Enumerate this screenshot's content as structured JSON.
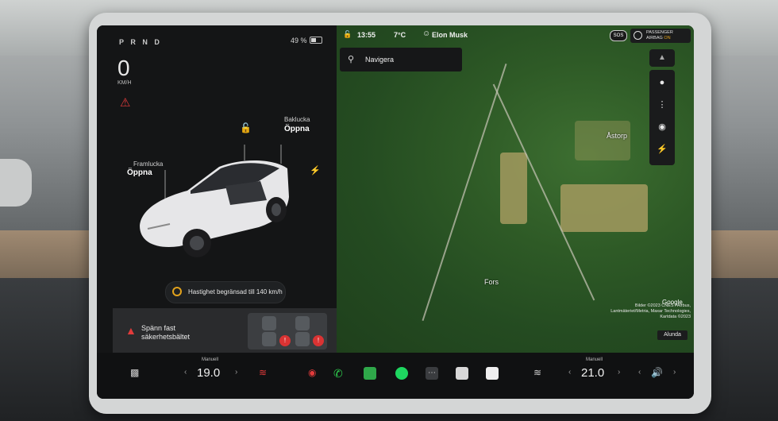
{
  "drive": {
    "gear": "P R N D",
    "speed": "0",
    "speed_unit": "KM/H",
    "battery_pct": "49 %"
  },
  "car_panel": {
    "trunk_label": "Baklucka",
    "trunk_action": "Öppna",
    "frunk_label": "Framlucka",
    "frunk_action": "Öppna",
    "speed_limit_text": "Hastighet begränsad till 140 km/h",
    "seatbelt_alert": "Spänn fast säkerhetsbältet"
  },
  "status_bar": {
    "time": "13:55",
    "temperature": "7°C",
    "user": "Elon Musk",
    "sos": "SOS",
    "airbag_line1": "PASSENGER",
    "airbag_line2": "AIRBAG",
    "airbag_state": "ON"
  },
  "map": {
    "search_placeholder": "Navigera",
    "places": [
      "Åstorp",
      "Fors"
    ],
    "attribution": "Bilder ©2023 CNES / Airbus, Lantmäteriet/Metria, Maxar Technologies, Kartdata ©2023",
    "provider": "Google",
    "nearby": "Alunda",
    "buttons": [
      "globe-icon",
      "traffic-icon",
      "pin-icon",
      "charging-icon"
    ]
  },
  "climate": {
    "left_mode": "Manuell",
    "left_temp": "19.0",
    "right_mode": "Manuell",
    "right_temp": "21.0"
  },
  "dock_apps": [
    "phone-icon",
    "chart-icon",
    "spotify-icon",
    "more-icon",
    "calendar-icon",
    "notes-icon"
  ],
  "colors": {
    "alert_red": "#e23b3b",
    "warning_amber": "#e2a21c",
    "map_green": "#2e5a26"
  }
}
